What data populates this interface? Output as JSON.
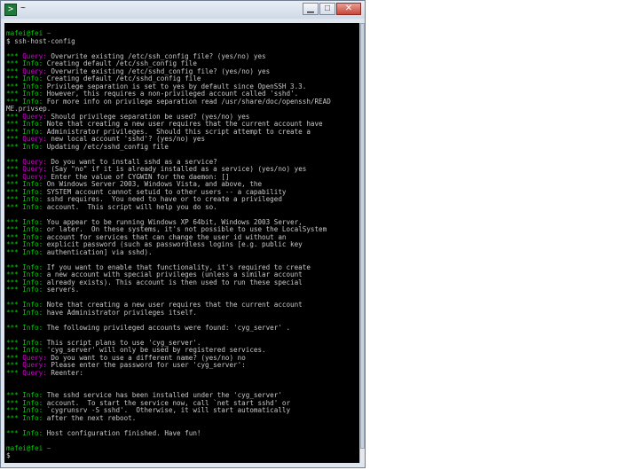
{
  "window": {
    "title": "~"
  },
  "terminal_lines": [
    {
      "type": "prompt",
      "text": "mafei@fei ~"
    },
    {
      "type": "plain",
      "text": "$ ssh-host-config"
    },
    {
      "type": "blank",
      "text": ""
    },
    {
      "type": "query",
      "text": "Overwrite existing /etc/ssh_config file? (yes/no) yes"
    },
    {
      "type": "info",
      "text": "Creating default /etc/ssh_config file"
    },
    {
      "type": "query",
      "text": "Overwrite existing /etc/sshd_config file? (yes/no) yes"
    },
    {
      "type": "info",
      "text": "Creating default /etc/sshd_config file"
    },
    {
      "type": "info",
      "text": "Privilege separation is set to yes by default since OpenSSH 3.3."
    },
    {
      "type": "info",
      "text": "However, this requires a non-privileged account called 'sshd'."
    },
    {
      "type": "info",
      "text": "For more info on privilege separation read /usr/share/doc/openssh/READ"
    },
    {
      "type": "plain",
      "text": "ME.privsep."
    },
    {
      "type": "query",
      "text": "Should privilege separation be used? (yes/no) yes"
    },
    {
      "type": "info",
      "text": "Note that creating a new user requires that the current account have"
    },
    {
      "type": "info",
      "text": "Administrator privileges.  Should this script attempt to create a"
    },
    {
      "type": "query",
      "text": "new local account 'sshd'? (yes/no) yes"
    },
    {
      "type": "info",
      "text": "Updating /etc/sshd_config file"
    },
    {
      "type": "blank",
      "text": ""
    },
    {
      "type": "query",
      "text": "Do you want to install sshd as a service?"
    },
    {
      "type": "query",
      "text": "(Say \"no\" if it is already installed as a service) (yes/no) yes"
    },
    {
      "type": "query",
      "text": "Enter the value of CYGWIN for the daemon: []"
    },
    {
      "type": "info",
      "text": "On Windows Server 2003, Windows Vista, and above, the"
    },
    {
      "type": "info",
      "text": "SYSTEM account cannot setuid to other users -- a capability"
    },
    {
      "type": "info",
      "text": "sshd requires.  You need to have or to create a privileged"
    },
    {
      "type": "info",
      "text": "account.  This script will help you do so."
    },
    {
      "type": "blank",
      "text": ""
    },
    {
      "type": "info",
      "text": "You appear to be running Windows XP 64bit, Windows 2003 Server,"
    },
    {
      "type": "info",
      "text": "or later.  On these systems, it's not possible to use the LocalSystem"
    },
    {
      "type": "info",
      "text": "account for services that can change the user id without an"
    },
    {
      "type": "info",
      "text": "explicit password (such as passwordless logins [e.g. public key"
    },
    {
      "type": "info",
      "text": "authentication] via sshd)."
    },
    {
      "type": "blank",
      "text": ""
    },
    {
      "type": "info",
      "text": "If you want to enable that functionality, it's required to create"
    },
    {
      "type": "info",
      "text": "a new account with special privileges (unless a similar account"
    },
    {
      "type": "info",
      "text": "already exists). This account is then used to run these special"
    },
    {
      "type": "info",
      "text": "servers."
    },
    {
      "type": "blank",
      "text": ""
    },
    {
      "type": "info",
      "text": "Note that creating a new user requires that the current account"
    },
    {
      "type": "info",
      "text": "have Administrator privileges itself."
    },
    {
      "type": "blank",
      "text": ""
    },
    {
      "type": "info",
      "text": "The following privileged accounts were found: 'cyg_server' ."
    },
    {
      "type": "blank",
      "text": ""
    },
    {
      "type": "info",
      "text": "This script plans to use 'cyg_server'."
    },
    {
      "type": "info",
      "text": "'cyg_server' will only be used by registered services."
    },
    {
      "type": "query",
      "text": "Do you want to use a different name? (yes/no) no"
    },
    {
      "type": "query",
      "text": "Please enter the password for user 'cyg_server':"
    },
    {
      "type": "query",
      "text": "Reenter:"
    },
    {
      "type": "blank",
      "text": ""
    },
    {
      "type": "blank",
      "text": ""
    },
    {
      "type": "info",
      "text": "The sshd service has been installed under the 'cyg_server'"
    },
    {
      "type": "info",
      "text": "account.  To start the service now, call `net start sshd' or"
    },
    {
      "type": "info",
      "text": "`cygrunsrv -S sshd'.  Otherwise, it will start automatically"
    },
    {
      "type": "info",
      "text": "after the next reboot."
    },
    {
      "type": "blank",
      "text": ""
    },
    {
      "type": "info",
      "text": "Host configuration finished. Have fun!"
    },
    {
      "type": "blank",
      "text": ""
    },
    {
      "type": "prompt",
      "text": "mafei@fei ~"
    },
    {
      "type": "plain",
      "text": "$"
    }
  ],
  "labels": {
    "stars": "***",
    "query": "Query:",
    "info": "Info:"
  },
  "colors": {
    "background": "#000000",
    "query": "#d000d0",
    "info": "#00d000",
    "text": "#c8c8c8"
  }
}
